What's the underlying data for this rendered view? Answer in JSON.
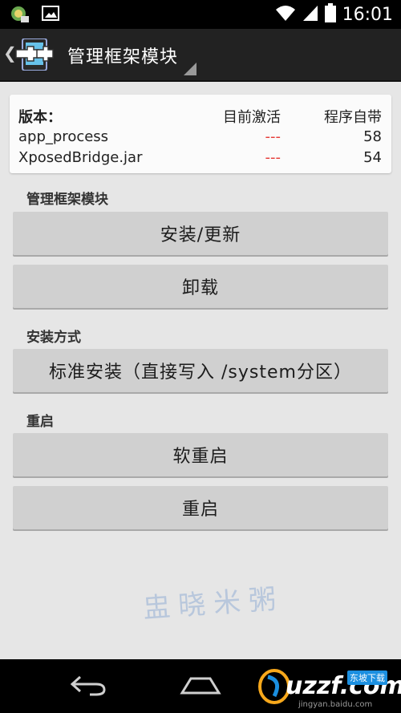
{
  "status_bar": {
    "time": "16:01"
  },
  "action_bar": {
    "title": "管理框架模块"
  },
  "version_card": {
    "header": {
      "label": "版本：",
      "active": "目前激活",
      "bundled": "程序自带"
    },
    "rows": [
      {
        "name": "app_process",
        "active": "---",
        "bundled": "58"
      },
      {
        "name": "XposedBridge.jar",
        "active": "---",
        "bundled": "54"
      }
    ]
  },
  "sections": {
    "framework": "管理框架模块",
    "install_method": "安装方式",
    "reboot": "重启"
  },
  "buttons": {
    "install_update": "安装/更新",
    "uninstall": "卸载",
    "standard_install": "标准安装（直接写入 /system分区）",
    "soft_reboot": "软重启",
    "reboot": "重启"
  },
  "watermark": "盅晓米粥",
  "navbar": {
    "logo_text": "uzzf.com",
    "logo_tag": "东坡下载",
    "site": "jingyan.baidu.com"
  },
  "colors": {
    "status_bar": "#000000",
    "action_bar": "#222222",
    "background": "#e6e6e6",
    "button": "#d0d0d0",
    "active_dash": "#e53935"
  }
}
